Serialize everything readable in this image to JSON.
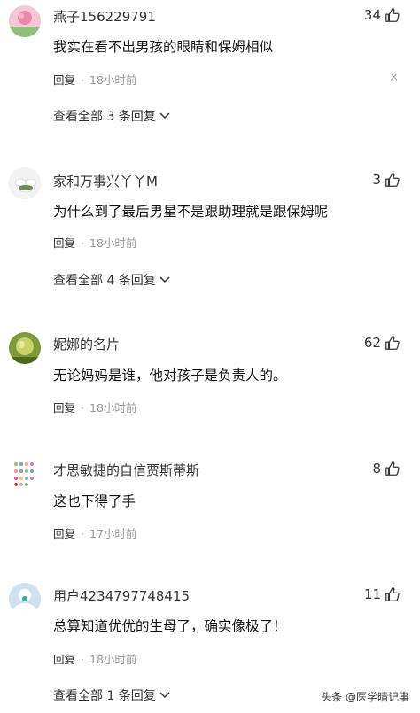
{
  "comments": [
    {
      "username": "燕子156229791",
      "likes": "34",
      "text": "我实在看不出男孩的眼睛和保姆相似",
      "reply_label": "回复",
      "separator": "·",
      "time": "18小时前",
      "close": "×",
      "more_replies": "查看全部 3 条回复"
    },
    {
      "username": "家和万事兴丫丫M",
      "likes": "3",
      "text": "为什么到了最后男星不是跟助理就是跟保姆呢",
      "reply_label": "回复",
      "separator": "·",
      "time": "18小时前",
      "more_replies": "查看全部 4 条回复"
    },
    {
      "username": "妮娜的名片",
      "likes": "62",
      "text": "无论妈妈是谁，他对孩子是负责人的。",
      "reply_label": "回复",
      "separator": "·",
      "time": "18小时前"
    },
    {
      "username": "才思敏捷的自信贾斯蒂斯",
      "likes": "8",
      "text": "这也下得了手",
      "reply_label": "回复",
      "separator": "·",
      "time": "17小时前"
    },
    {
      "username": "用户4234797748415",
      "likes": "11",
      "text": "总算知道优优的生母了，确实像极了！",
      "reply_label": "回复",
      "separator": "·",
      "time": "18小时前",
      "more_replies": "查看全部 1 条回复"
    }
  ],
  "watermark": "头条 @医学晴记事",
  "colors": {
    "text": "#111111",
    "meta": "#999999",
    "accent": "#333333"
  }
}
